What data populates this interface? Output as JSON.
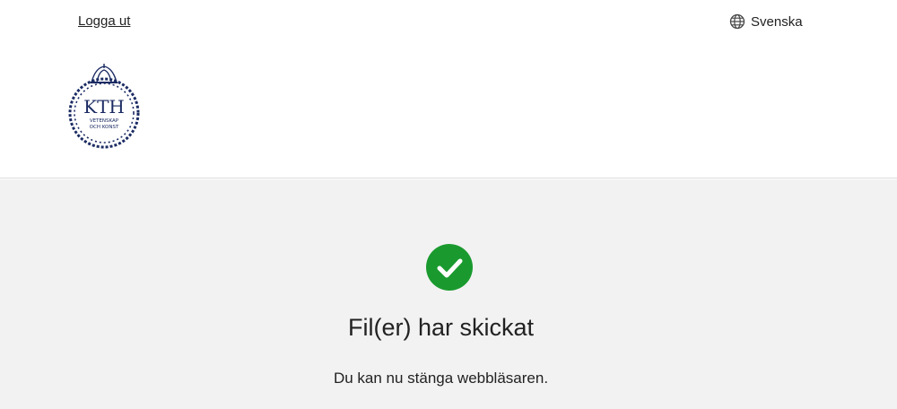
{
  "header": {
    "logout_label": "Logga ut",
    "language_label": "Svenska",
    "logo": {
      "brand": "KTH",
      "line1": "VETENSKAP",
      "line2": "OCH KONST",
      "color": "#1b2b63"
    }
  },
  "main": {
    "status_icon": "check-circle-icon",
    "status_color": "#1a9a2e",
    "title": "Fil(er) har skickat",
    "message": "Du kan nu stänga webbläsaren."
  }
}
